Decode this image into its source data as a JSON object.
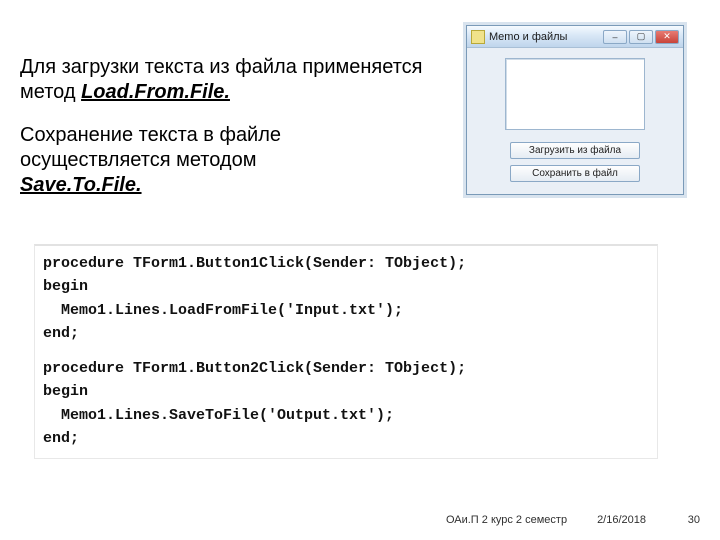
{
  "text": {
    "p1_a": "Для загрузки текста из файла применяется метод ",
    "p1_b": "Load.From.File.",
    "p2_a": "Сохранение текста в файле осуществляется методом ",
    "p2_b": "Save.To.File."
  },
  "window": {
    "title": "Memo и файлы",
    "btn_load": "Загрузить из файла",
    "btn_save": "Сохранить в файл"
  },
  "code": {
    "l1": "procedure TForm1.Button1Click(Sender: TObject);",
    "l2": "begin",
    "l3": "  Memo1.Lines.LoadFromFile('Input.txt');",
    "l4": "end;",
    "l6": "procedure TForm1.Button2Click(Sender: TObject);",
    "l7": "begin",
    "l8": "  Memo1.Lines.SaveToFile('Output.txt');",
    "l9": "end;"
  },
  "footer": {
    "course": "ОАи.П 2 курс 2 семестр",
    "date": "2/16/2018",
    "page": "30"
  }
}
